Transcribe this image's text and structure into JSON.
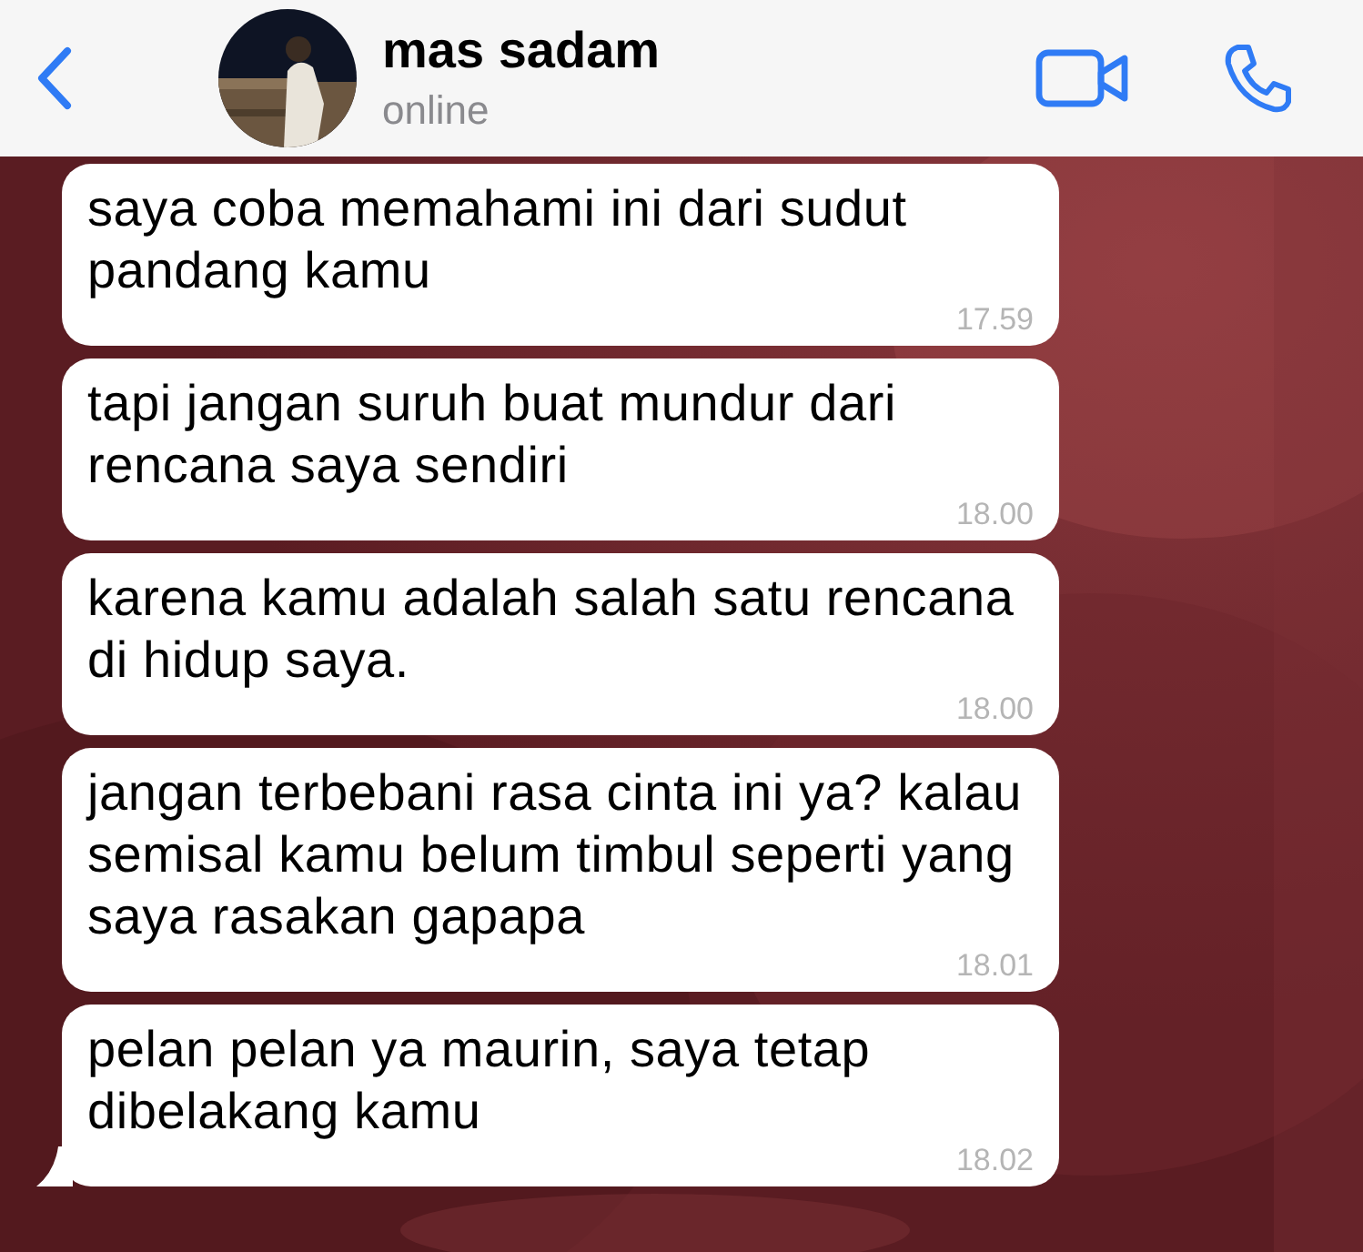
{
  "header": {
    "name": "mas sadam",
    "status": "online"
  },
  "messages": [
    {
      "text": "saya coba memahami ini dari sudut pandang kamu",
      "time": "17.59",
      "tail": false
    },
    {
      "text": "tapi jangan suruh buat mundur dari rencana saya sendiri",
      "time": "18.00",
      "tail": false
    },
    {
      "text": "karena kamu adalah salah satu rencana di hidup saya.",
      "time": "18.00",
      "tail": false
    },
    {
      "text": "jangan terbebani rasa cinta ini ya? kalau semisal kamu belum timbul seperti yang saya rasakan gapapa",
      "time": "18.01",
      "tail": false
    },
    {
      "text": "pelan pelan ya maurin, saya tetap dibelakang kamu",
      "time": "18.02",
      "tail": true
    }
  ]
}
